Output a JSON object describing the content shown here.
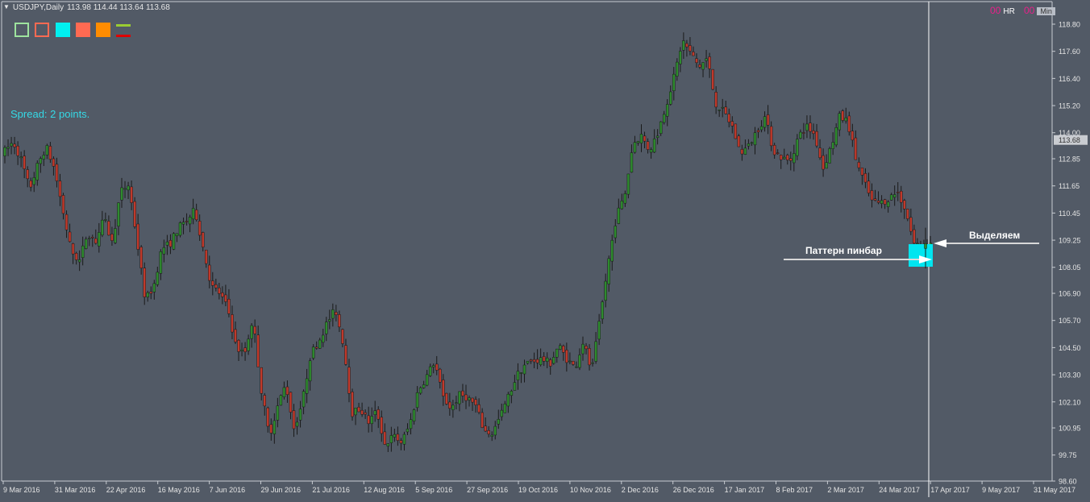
{
  "header": {
    "symbol": "USDJPY,Daily",
    "ohlc": "113.98 114.44 113.64 113.68"
  },
  "spread_text": "Spread: 2 points.",
  "timeframe_buttons": [
    {
      "value": "00",
      "label": "HR"
    },
    {
      "value": "00",
      "label": "Min"
    }
  ],
  "toolbar_colors": [
    "#9ee39e",
    "#ff6a52",
    "#00f0f0",
    "#ff6a52",
    "#ff8c00",
    "#9acd32",
    "#e00000"
  ],
  "annotations": {
    "pattern_label": "Паттерн пинбар",
    "select_label": "Выделяем"
  },
  "chart_data": {
    "type": "candlestick",
    "title": "",
    "xlabel": "",
    "ylabel": "",
    "ylim": [
      98.6,
      119.6
    ],
    "y_ticks": [
      "118.80",
      "117.60",
      "116.40",
      "115.20",
      "114.00",
      "112.85",
      "111.65",
      "110.45",
      "109.25",
      "108.05",
      "106.90",
      "105.70",
      "104.50",
      "103.30",
      "102.10",
      "100.95",
      "99.75",
      "98.60"
    ],
    "x_ticks": [
      "9 Mar 2016",
      "31 Mar 2016",
      "22 Apr 2016",
      "16 May 2016",
      "7 Jun 2016",
      "29 Jun 2016",
      "21 Jul 2016",
      "12 Aug 2016",
      "5 Sep 2016",
      "27 Sep 2016",
      "19 Oct 2016",
      "10 Nov 2016",
      "2 Dec 2016",
      "26 Dec 2016",
      "17 Jan 2017",
      "8 Feb 2017",
      "2 Mar 2017",
      "24 Mar 2017",
      "17 Apr 2017",
      "9 May 2017",
      "31 May 2017"
    ],
    "current_price": "113.68",
    "close_series": [
      113.2,
      113.6,
      112.8,
      111.5,
      112.6,
      113.4,
      112.4,
      110.6,
      108.8,
      108.3,
      109.6,
      109.2,
      110.2,
      109.1,
      111.4,
      111.7,
      109.2,
      106.6,
      107.2,
      108.9,
      109.1,
      109.8,
      110.1,
      110.6,
      108.9,
      107.2,
      106.9,
      106.2,
      104.5,
      104.2,
      105.8,
      102.7,
      100.6,
      101.9,
      102.9,
      100.9,
      102.1,
      104.2,
      104.8,
      105.6,
      106.2,
      104.6,
      101.6,
      101.8,
      101.2,
      101.7,
      100.2,
      100.6,
      100.3,
      101.1,
      102.6,
      103.2,
      103.9,
      102.3,
      101.8,
      102.4,
      102.3,
      101.9,
      100.8,
      100.7,
      101.5,
      102.4,
      103.3,
      103.8,
      103.9,
      104.0,
      103.8,
      104.6,
      104.0,
      103.6,
      104.8,
      103.4,
      105.7,
      108.2,
      110.3,
      111.2,
      113.5,
      113.9,
      113.2,
      114.0,
      115.2,
      116.5,
      118.1,
      117.5,
      116.9,
      117.3,
      115.3,
      114.9,
      114.3,
      113.1,
      113.4,
      114.1,
      114.7,
      113.2,
      112.9,
      112.7,
      113.8,
      114.3,
      113.9,
      112.4,
      113.4,
      114.7,
      114.5,
      112.8,
      111.8,
      110.9,
      110.9,
      111.1,
      111.4,
      110.6,
      109.1,
      109.0,
      109.1
    ]
  }
}
